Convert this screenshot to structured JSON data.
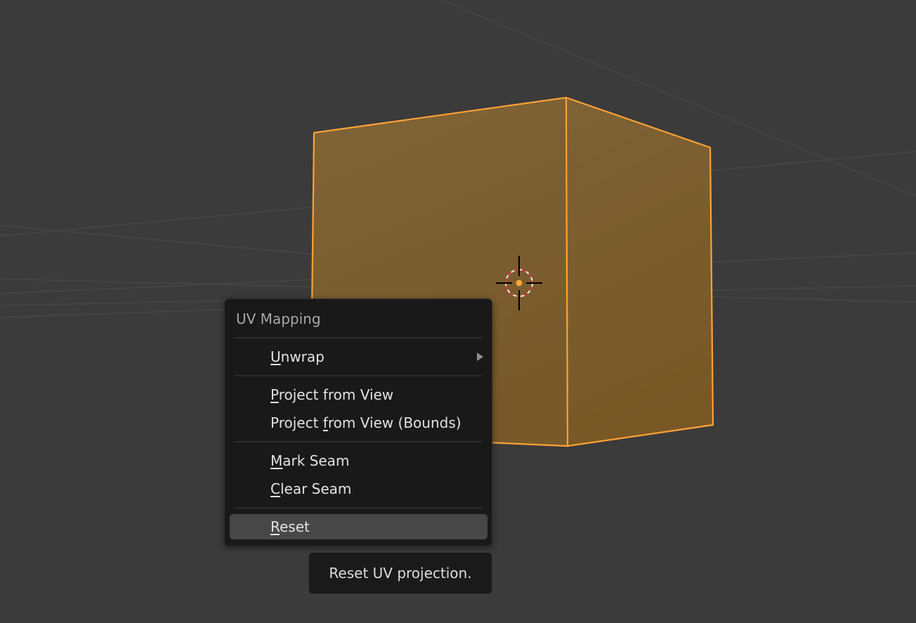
{
  "colors": {
    "background": "#3b3b3b",
    "grid_line": "#4a4a4a",
    "cube_fill": "#7d6230",
    "cube_outline": "#ffa235",
    "menu_bg": "#191919",
    "menu_highlight": "#474747"
  },
  "viewport": {
    "object": "cube",
    "selected": true,
    "cursor_icon": "3d-cursor-icon"
  },
  "uv_menu": {
    "title": "UV Mapping",
    "unwrap": {
      "hotkey": "U",
      "rest": "nwrap",
      "has_submenu": true
    },
    "project_from_view": {
      "hotkey": "P",
      "rest": "roject from View"
    },
    "project_from_view_bounds": {
      "pre": "Project ",
      "hotkey": "f",
      "rest": "rom View (Bounds)"
    },
    "mark_seam": {
      "hotkey": "M",
      "rest": "ark Seam"
    },
    "clear_seam": {
      "hotkey": "C",
      "rest": "lear Seam"
    },
    "reset": {
      "hotkey": "R",
      "rest": "eset",
      "highlighted": true
    }
  },
  "tooltip": {
    "text": "Reset UV projection."
  }
}
